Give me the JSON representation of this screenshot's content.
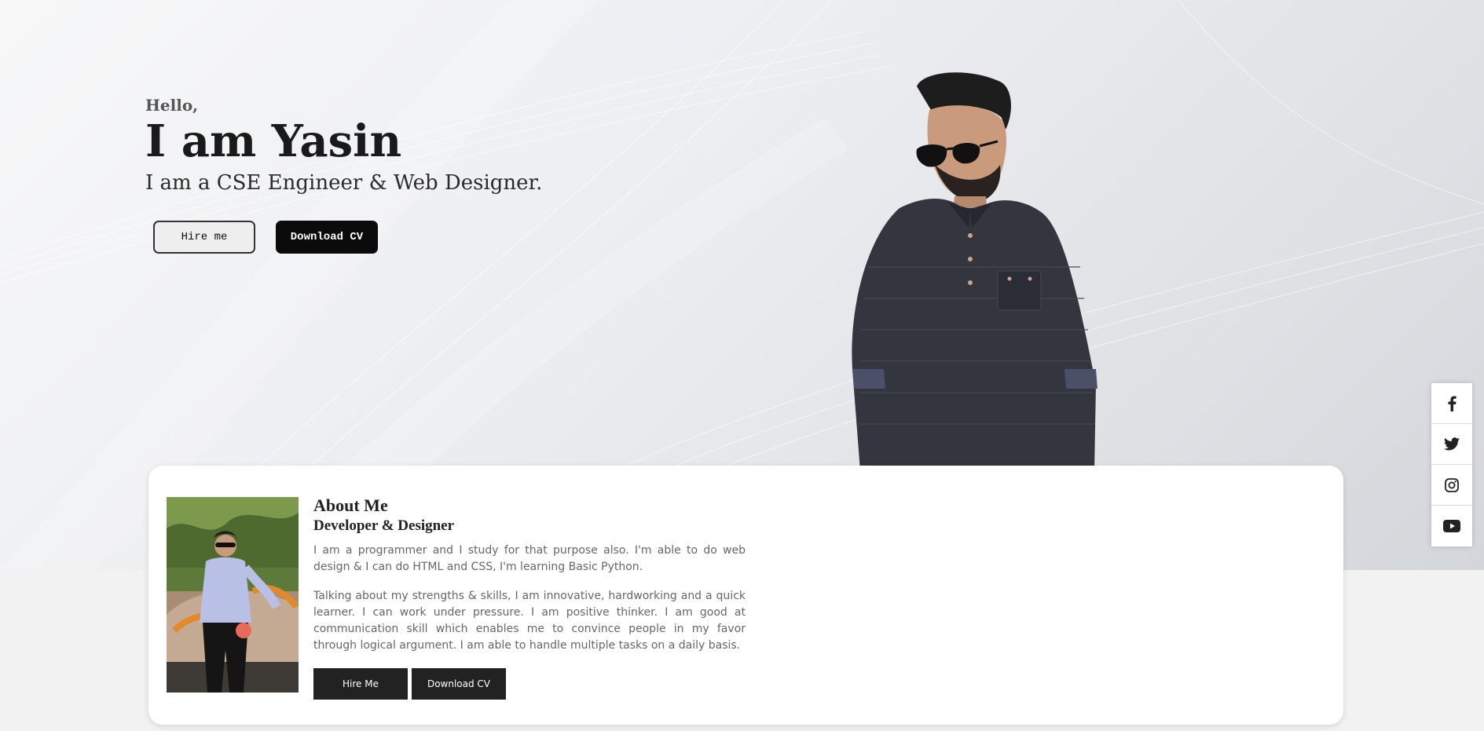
{
  "hero": {
    "greeting": "Hello,",
    "name": "I am Yasin",
    "tagline": "I am a CSE Engineer & Web Designer.",
    "hire_label": "Hire me",
    "download_label": "Download CV"
  },
  "social": [
    {
      "icon": "facebook-icon"
    },
    {
      "icon": "twitter-icon"
    },
    {
      "icon": "instagram-icon"
    },
    {
      "icon": "youtube-icon"
    }
  ],
  "about": {
    "title": "About Me",
    "subtitle": "Developer & Designer",
    "paragraph1": "I am a programmer and I study for that purpose also. I'm able to do web design & I can do HTML and CSS, I'm learning Basic Python.",
    "paragraph2": "Talking about my strengths & skills, I am innovative, hardworking and a quick learner. I can work under pressure. I am positive thinker. I am good at communication skill which enables me to convince people in my favor through logical argument. I am able to handle multiple tasks on a daily basis.",
    "hire_label": "Hire Me",
    "download_label": "Download CV"
  },
  "colors": {
    "dark": "#0b0b0b",
    "card_bg": "#ffffff",
    "page_bg": "#f2f2f2"
  }
}
